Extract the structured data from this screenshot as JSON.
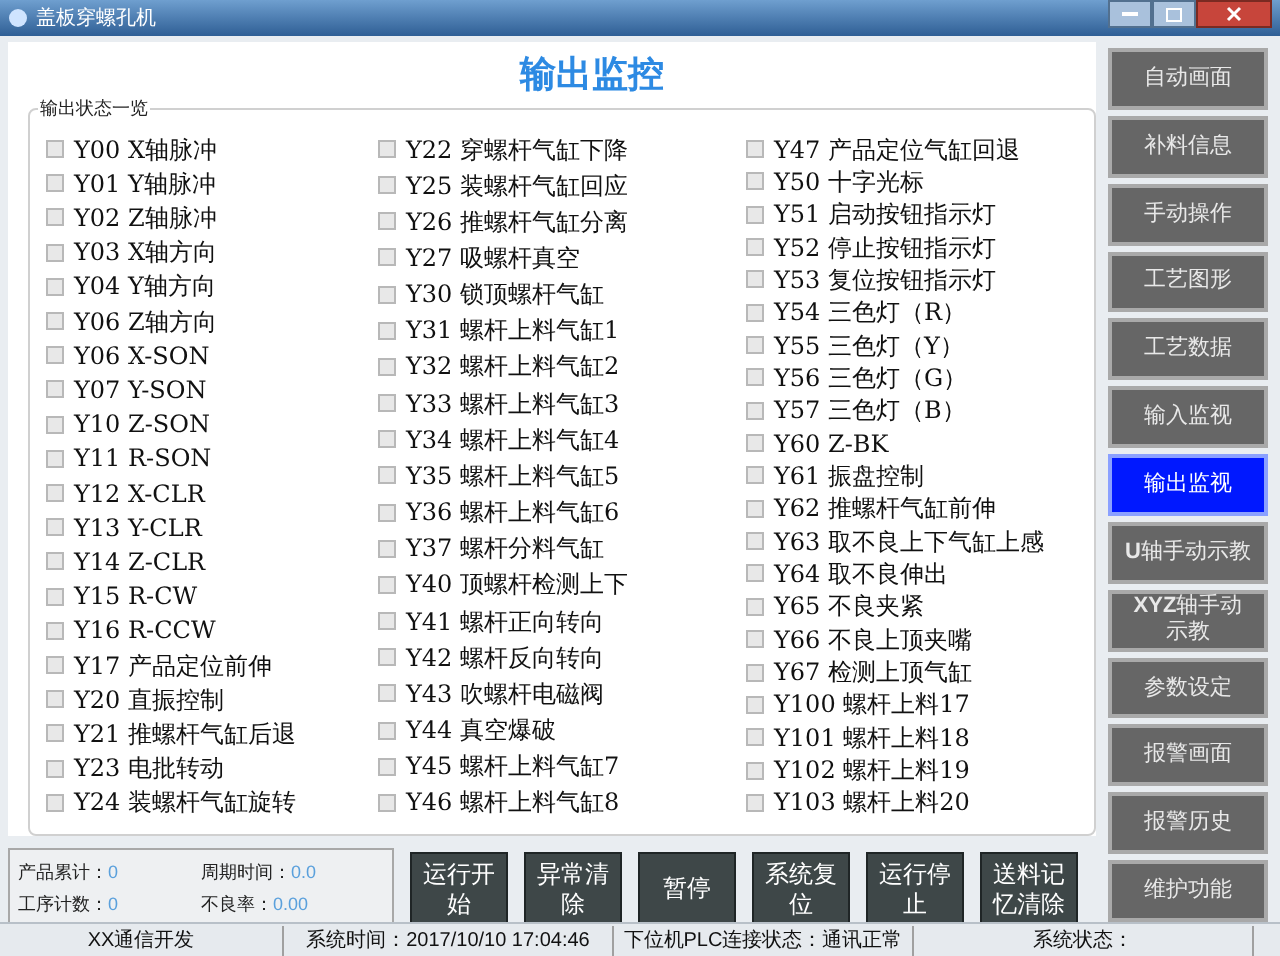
{
  "window": {
    "title": "盖板穿螺孔机"
  },
  "heading": "输出监控",
  "group": {
    "title": "输出状态一览",
    "columns": [
      [
        {
          "label": "Y00 X轴脉冲",
          "checked": false
        },
        {
          "label": "Y01 Y轴脉冲",
          "checked": false
        },
        {
          "label": "Y02 Z轴脉冲",
          "checked": false
        },
        {
          "label": "Y03 X轴方向",
          "checked": false
        },
        {
          "label": "Y04 Y轴方向",
          "checked": false
        },
        {
          "label": "Y06 Z轴方向",
          "checked": false
        },
        {
          "label": "Y06 X-SON",
          "checked": false
        },
        {
          "label": "Y07 Y-SON",
          "checked": false
        },
        {
          "label": "Y10 Z-SON",
          "checked": false
        },
        {
          "label": "Y11 R-SON",
          "checked": false
        },
        {
          "label": "Y12 X-CLR",
          "checked": false
        },
        {
          "label": "Y13 Y-CLR",
          "checked": false
        },
        {
          "label": "Y14 Z-CLR",
          "checked": false
        },
        {
          "label": "Y15 R-CW",
          "checked": false
        },
        {
          "label": "Y16 R-CCW",
          "checked": false
        },
        {
          "label": "Y17 产品定位前伸",
          "checked": false
        },
        {
          "label": "Y20 直振控制",
          "checked": false
        },
        {
          "label": "Y21 推螺杆气缸后退",
          "checked": false
        },
        {
          "label": "Y23 电批转动",
          "checked": false
        },
        {
          "label": "Y24 装螺杆气缸旋转",
          "checked": false
        }
      ],
      [
        {
          "label": "Y22 穿螺杆气缸下降",
          "checked": false
        },
        {
          "label": "Y25 装螺杆气缸回应",
          "checked": false
        },
        {
          "label": "Y26 推螺杆气缸分离",
          "checked": false
        },
        {
          "label": "Y27 吸螺杆真空",
          "checked": false
        },
        {
          "label": "Y30 锁顶螺杆气缸",
          "checked": false
        },
        {
          "label": "Y31 螺杆上料气缸1",
          "checked": false
        },
        {
          "label": "Y32 螺杆上料气缸2",
          "checked": false
        },
        {
          "label": "Y33 螺杆上料气缸3",
          "checked": false
        },
        {
          "label": "Y34 螺杆上料气缸4",
          "checked": false
        },
        {
          "label": "Y35 螺杆上料气缸5",
          "checked": false
        },
        {
          "label": "Y36 螺杆上料气缸6",
          "checked": false
        },
        {
          "label": "Y37 螺杆分料气缸",
          "checked": false
        },
        {
          "label": "Y40 顶螺杆检测上下",
          "checked": false
        },
        {
          "label": "Y41 螺杆正向转向",
          "checked": false
        },
        {
          "label": "Y42 螺杆反向转向",
          "checked": false
        },
        {
          "label": "Y43 吹螺杆电磁阀",
          "checked": false
        },
        {
          "label": "Y44 真空爆破",
          "checked": false
        },
        {
          "label": "Y45 螺杆上料气缸7",
          "checked": false
        },
        {
          "label": "Y46 螺杆上料气缸8",
          "checked": false
        }
      ],
      [
        {
          "label": "Y47 产品定位气缸回退",
          "checked": false
        },
        {
          "label": "Y50 十字光标",
          "checked": false
        },
        {
          "label": "Y51 启动按钮指示灯",
          "checked": false
        },
        {
          "label": "Y52 停止按钮指示灯",
          "checked": false
        },
        {
          "label": "Y53 复位按钮指示灯",
          "checked": false
        },
        {
          "label": "Y54 三色灯（R）",
          "checked": false
        },
        {
          "label": "Y55 三色灯（Y）",
          "checked": false
        },
        {
          "label": "Y56 三色灯（G）",
          "checked": false
        },
        {
          "label": "Y57 三色灯（B）",
          "checked": false
        },
        {
          "label": "Y60 Z-BK",
          "checked": false
        },
        {
          "label": "Y61 振盘控制",
          "checked": false
        },
        {
          "label": "Y62 推螺杆气缸前伸",
          "checked": false
        },
        {
          "label": "Y63 取不良上下气缸上感",
          "checked": false
        },
        {
          "label": "Y64 取不良伸出",
          "checked": false
        },
        {
          "label": "Y65 不良夹紧",
          "checked": false
        },
        {
          "label": "Y66 不良上顶夹嘴",
          "checked": false
        },
        {
          "label": "Y67 检测上顶气缸",
          "checked": false
        },
        {
          "label": "Y100 螺杆上料17",
          "checked": false
        },
        {
          "label": "Y101 螺杆上料18",
          "checked": false
        },
        {
          "label": "Y102 螺杆上料19",
          "checked": false
        },
        {
          "label": "Y103 螺杆上料20",
          "checked": false
        }
      ]
    ]
  },
  "stats": [
    {
      "label": "产品累计：",
      "value": "0"
    },
    {
      "label": "周期时间：",
      "value": "0.0"
    },
    {
      "label": "工序计数：",
      "value": "0"
    },
    {
      "label": "不良率：",
      "value": "0.00"
    }
  ],
  "actions": [
    "运行开始",
    "异常清除",
    "暂停",
    "系统复位",
    "运行停止",
    "送料记忆清除"
  ],
  "nav": [
    {
      "label": "自动画面",
      "selected": false
    },
    {
      "label": "补料信息",
      "selected": false
    },
    {
      "label": "手动操作",
      "selected": false
    },
    {
      "label": "工艺图形",
      "selected": false
    },
    {
      "label": "工艺数据",
      "selected": false
    },
    {
      "label": "输入监视",
      "selected": false
    },
    {
      "label": "输出监视",
      "selected": true
    },
    {
      "label": "**U**轴手动示教",
      "selected": false
    },
    {
      "label": "**XYZ**轴手动示教",
      "selected": false
    },
    {
      "label": "参数设定",
      "selected": false
    },
    {
      "label": "报警画面",
      "selected": false
    },
    {
      "label": "报警历史",
      "selected": false
    },
    {
      "label": "维护功能",
      "selected": false
    }
  ],
  "status_bar": [
    "XX通信开发",
    "系统时间：2017/10/10 17:04:46",
    "下位机PLC连接状态：通讯正常",
    "系统状态："
  ]
}
